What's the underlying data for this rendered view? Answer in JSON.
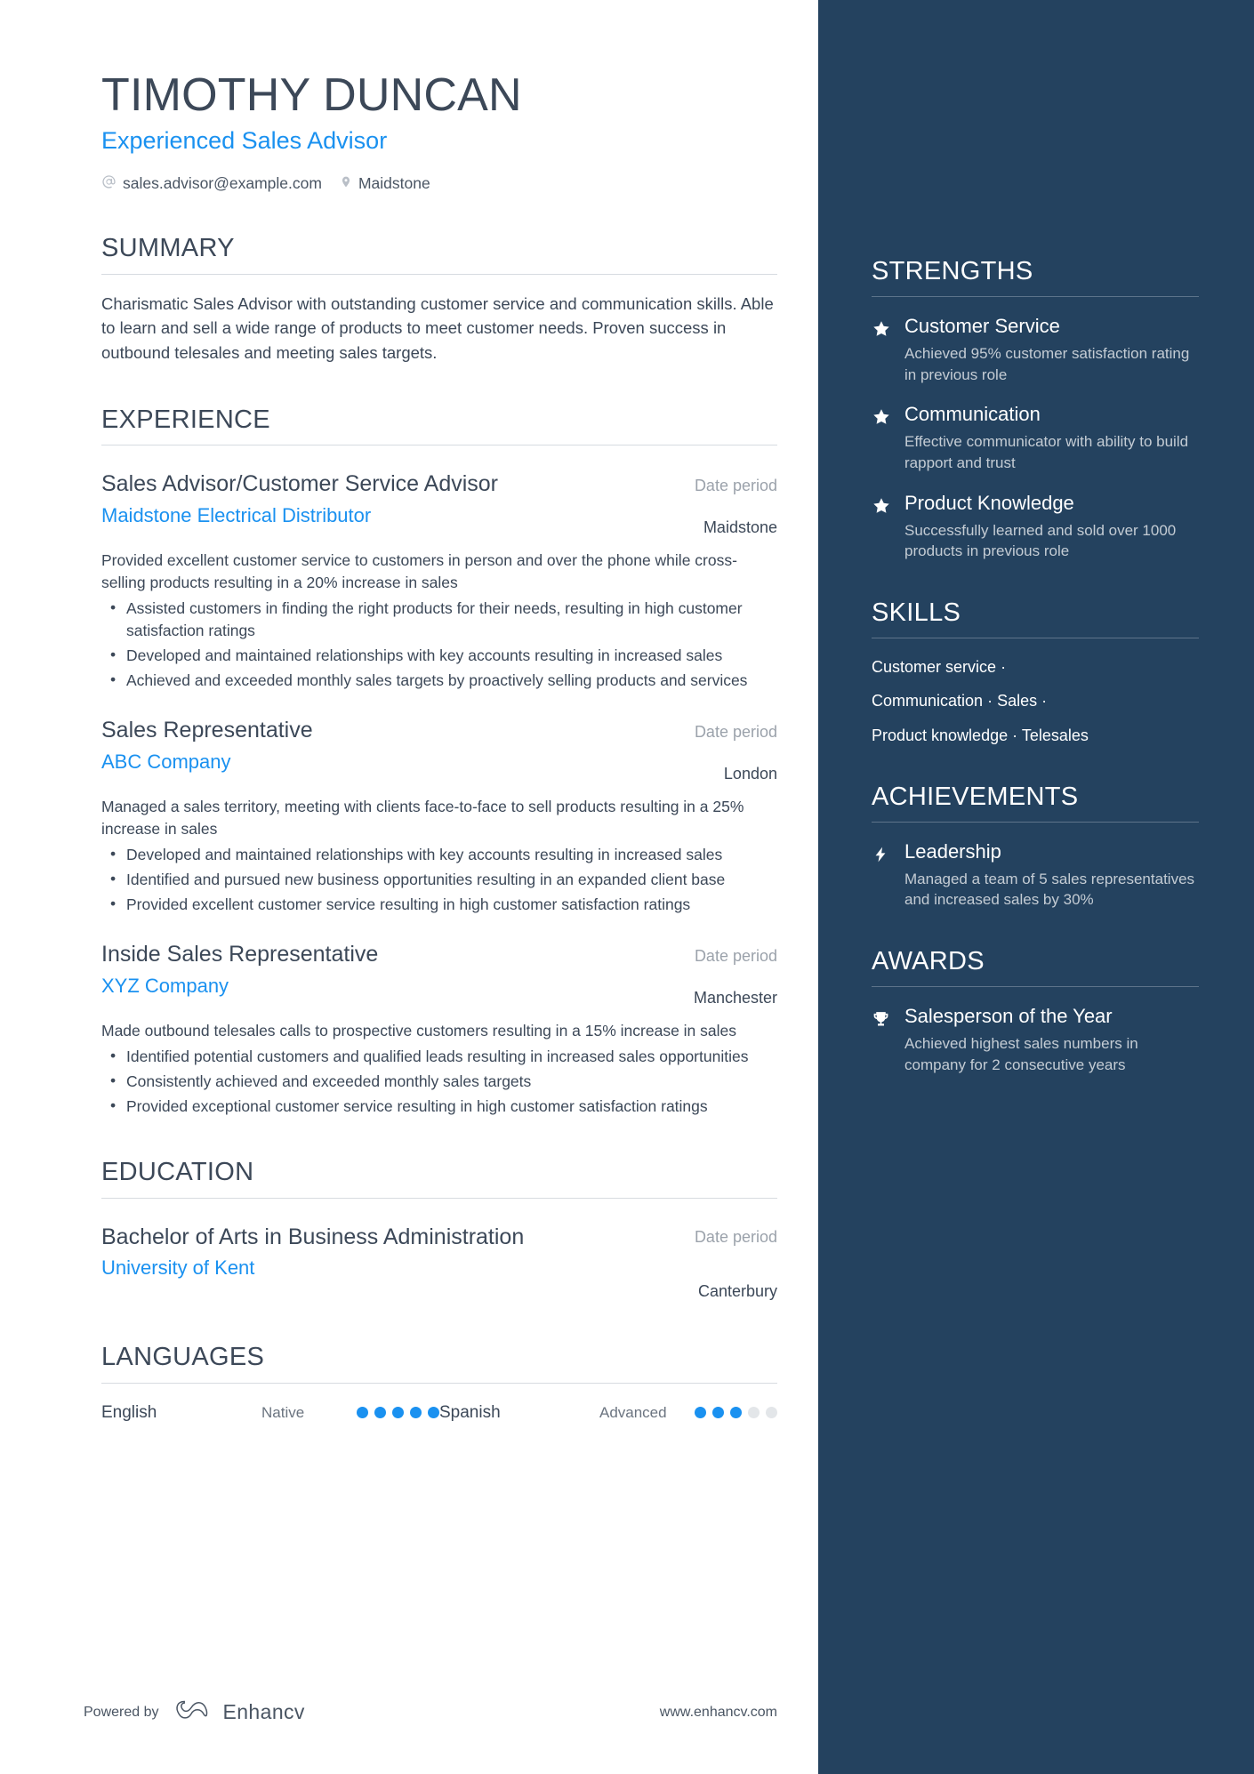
{
  "header": {
    "name": "TIMOTHY DUNCAN",
    "job_title": "Experienced Sales Advisor",
    "email": "sales.advisor@example.com",
    "location": "Maidstone",
    "email_icon": "at-icon",
    "location_icon": "map-pin-icon"
  },
  "summary": {
    "title": "SUMMARY",
    "text": "Charismatic Sales Advisor with outstanding customer service and communication skills. Able to learn and sell a wide range of products to meet customer needs. Proven success in outbound telesales and meeting sales targets."
  },
  "experience": {
    "title": "EXPERIENCE",
    "entries": [
      {
        "role": "Sales Advisor/Customer Service Advisor",
        "company": "Maidstone Electrical Distributor",
        "date": "Date period",
        "location": "Maidstone",
        "description": "Provided excellent customer service to customers in person and over the phone while cross-selling products resulting in a 20% increase in sales",
        "bullets": [
          "Assisted customers in finding the right products for their needs, resulting in high customer satisfaction ratings",
          "Developed and maintained relationships with key accounts resulting in increased sales",
          "Achieved and exceeded monthly sales targets by proactively selling products and services"
        ]
      },
      {
        "role": "Sales Representative",
        "company": "ABC Company",
        "date": "Date period",
        "location": "London",
        "description": "Managed a sales territory, meeting with clients face-to-face to sell products resulting in a 25% increase in sales",
        "bullets": [
          "Developed and maintained relationships with key accounts resulting in increased sales",
          "Identified and pursued new business opportunities resulting in an expanded client base",
          "Provided excellent customer service resulting in high customer satisfaction ratings"
        ]
      },
      {
        "role": "Inside Sales Representative",
        "company": "XYZ Company",
        "date": "Date period",
        "location": "Manchester",
        "description": "Made outbound telesales calls to prospective customers resulting in a 15% increase in sales",
        "bullets": [
          "Identified potential customers and qualified leads resulting in increased sales opportunities",
          "Consistently achieved and exceeded monthly sales targets",
          "Provided exceptional customer service resulting in high customer satisfaction ratings"
        ]
      }
    ]
  },
  "education": {
    "title": "EDUCATION",
    "entries": [
      {
        "degree": "Bachelor of Arts in Business Administration",
        "school": "University of Kent",
        "date": "Date period",
        "location": "Canterbury"
      }
    ]
  },
  "languages": {
    "title": "LANGUAGES",
    "items": [
      {
        "name": "English",
        "level": "Native",
        "filled": 5,
        "total": 5
      },
      {
        "name": "Spanish",
        "level": "Advanced",
        "filled": 3,
        "total": 5
      }
    ]
  },
  "footer": {
    "powered_by": "Powered by",
    "brand": "Enhancv",
    "brand_icon": "enhancv-logo-icon",
    "url": "www.enhancv.com"
  },
  "sidebar": {
    "strengths": {
      "title": "STRENGTHS",
      "icon": "star-icon",
      "items": [
        {
          "title": "Customer Service",
          "desc": "Achieved 95% customer satisfaction rating in previous role"
        },
        {
          "title": "Communication",
          "desc": "Effective communicator with ability to build rapport and trust"
        },
        {
          "title": "Product Knowledge",
          "desc": "Successfully learned and sold over 1000 products in previous role"
        }
      ]
    },
    "skills": {
      "title": "SKILLS",
      "lines": [
        [
          "Customer service"
        ],
        [
          "Communication",
          "Sales"
        ],
        [
          "Product knowledge",
          "Telesales"
        ]
      ],
      "separator": "·"
    },
    "achievements": {
      "title": "ACHIEVEMENTS",
      "icon": "lightning-bolt-icon",
      "items": [
        {
          "title": "Leadership",
          "desc": "Managed a team of 5 sales representatives and increased sales by 30%"
        }
      ]
    },
    "awards": {
      "title": "AWARDS",
      "icon": "trophy-icon",
      "items": [
        {
          "title": "Salesperson of the Year",
          "desc": "Achieved highest sales numbers in company for 2 consecutive years"
        }
      ]
    }
  },
  "colors": {
    "accent_blue": "#1a91f0",
    "sidebar_bg": "#24425f",
    "text_dark": "#3c4858",
    "muted": "#9ba2ab"
  }
}
